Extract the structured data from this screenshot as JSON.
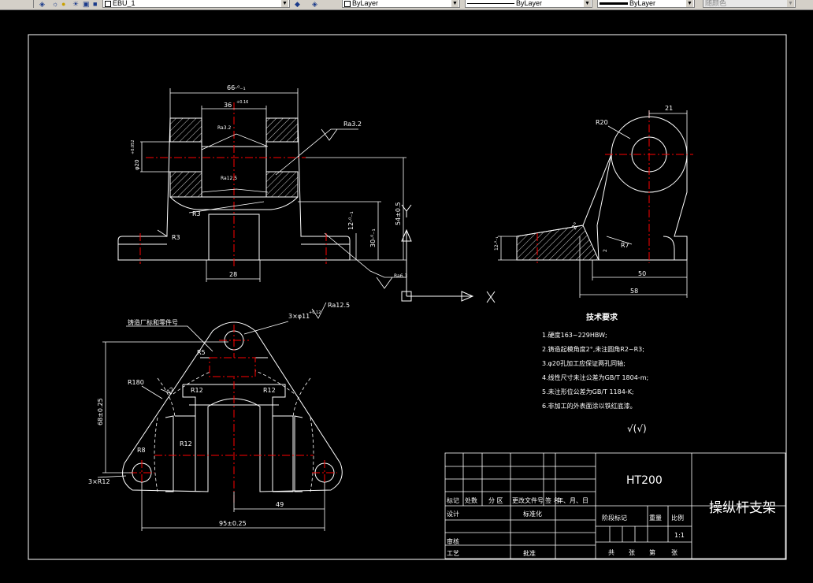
{
  "toolbar": {
    "layer_name": "EBU_1",
    "color_combo": "ByLayer",
    "linetype_combo": "ByLayer",
    "lineweight_combo": "ByLayer",
    "plotstyle_combo": "随颜色"
  },
  "colors": {
    "background": "#000000",
    "geometry": "#ffffff",
    "centerline": "#ff0000",
    "hatch": "#ffffff",
    "toolbar": "#d4d0c8"
  },
  "front_view": {
    "dim_top_width": "66-⁰₋₁",
    "dim_bore_width": "36",
    "dim_bore_tol": "+0.16",
    "ra_left_inner": "Ra3.2",
    "ra_right": "Ra3.2",
    "ra_lower_inner": "Ra12.5",
    "dim_hole_dia": "φ20",
    "dim_hole_tol": "+0.052",
    "fillet_r3_a": "R3",
    "fillet_r3_b": "R3",
    "dim_height_total": "54±0.5",
    "dim_height_mid": "30-⁰₋₁",
    "dim_height_low": "12-⁰₋₁",
    "dim_slot_width": "28",
    "ra_base": "Ra6.3"
  },
  "side_view": {
    "dim_radius": "R20",
    "dim_top_offset": "21",
    "dim_angle": "2°",
    "dim_base_thickness": "12-⁰₋₁",
    "dim_fillet_r7": "R7",
    "dim_2": "2",
    "dim_width_50": "50",
    "dim_width_58": "58"
  },
  "top_view": {
    "holes_note": "3×φ11",
    "holes_tol": "+0.12",
    "ra_holes": "Ra12.5",
    "casting_note": "铸造厂标和零件号",
    "dim_r5": "R5",
    "dim_r180": "R180",
    "dim_12": "12",
    "dim_r12_a": "R12",
    "dim_r12_b": "R12",
    "dim_r12_c": "R12",
    "dim_r8": "R8",
    "holes_r12": "3×R12",
    "dim_height": "68±0.25",
    "dim_49": "49",
    "dim_width": "95±0.25"
  },
  "tech_requirements": {
    "title": "技术要求",
    "items": [
      "1.硬度163~229HBW;",
      "2.铸造起模角度2°,未注圆角R2~R3;",
      "3.φ20孔加工应保证两孔同轴;",
      "4.线性尺寸未注公差为GB/T 1804-m;",
      "5.未注形位公差为GB/T 1184-K;",
      "6.非加工的外表面涂以铁红底漆。"
    ],
    "roughness_symbol": "√(√)"
  },
  "title_block": {
    "material": "HT200",
    "part_name": "操纵杆支架",
    "row_labels": [
      "标记",
      "处数",
      "分 区",
      "更改文件号",
      "签 名",
      "年、月、日"
    ],
    "design": "设计",
    "standardization": "标准化",
    "review": "审核",
    "process": "工艺",
    "approve": "批准",
    "stage_mark": "阶段标记",
    "weight": "重量",
    "scale": "比例",
    "scale_value": "1:1",
    "sheets_total": "共",
    "sheets_unit": "张",
    "sheet_no": "第",
    "sheet_unit2": "张"
  }
}
